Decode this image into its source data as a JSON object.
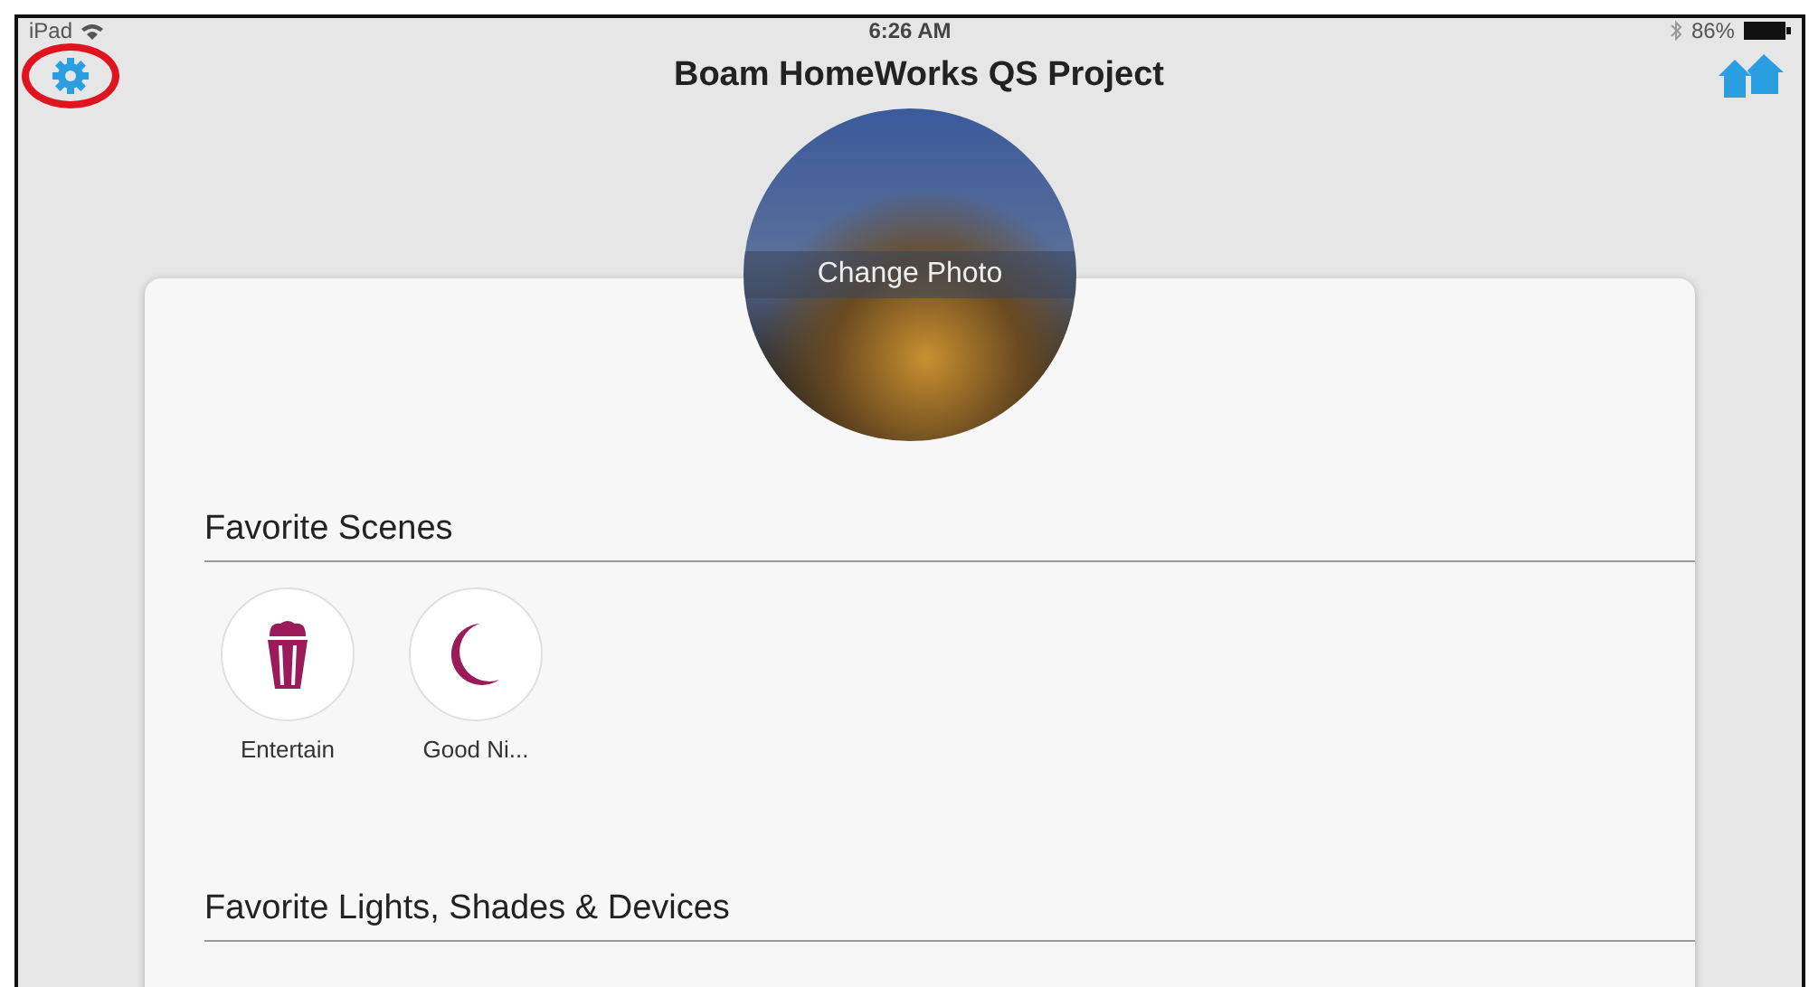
{
  "status_bar": {
    "device": "iPad",
    "time": "6:26 AM",
    "battery": "86%"
  },
  "nav": {
    "title": "Boam HomeWorks QS Project"
  },
  "photo": {
    "label": "Change Photo"
  },
  "sections": [
    {
      "title": "Favorite Scenes",
      "scenes": [
        {
          "label": "Entertain",
          "kind": "popcorn"
        },
        {
          "label": "Good Ni...",
          "kind": "moon"
        }
      ]
    },
    {
      "title": "Favorite Lights, Shades & Devices"
    }
  ]
}
